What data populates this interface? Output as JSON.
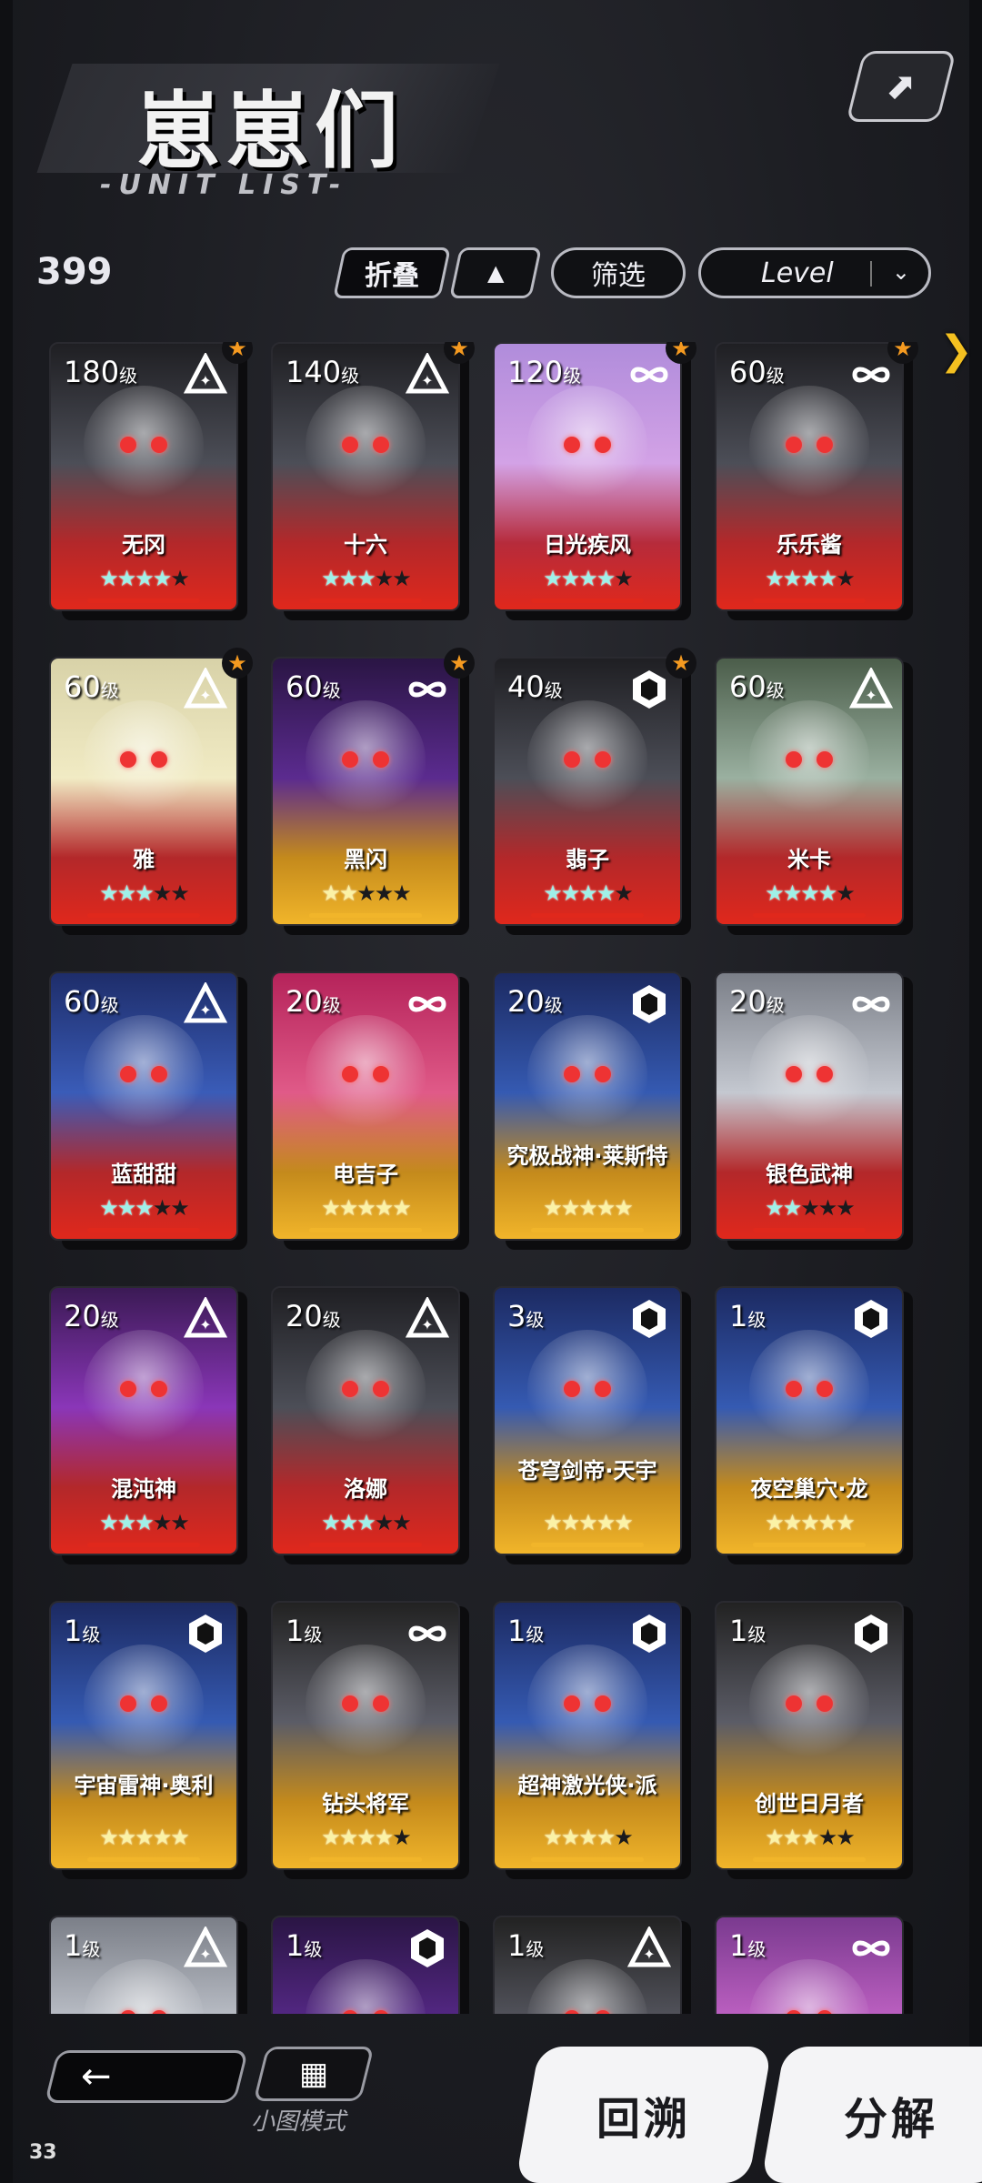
{
  "header": {
    "title": "崽崽们",
    "subtitle": "-UNIT LIST-",
    "count": "399",
    "fold_label": "折叠",
    "sort_dir_icon": "up-triangle-icon",
    "filter_label": "筛选",
    "sort_label": "Level",
    "corner_icon": "ranking-icon"
  },
  "colors": {
    "red_rarity": "#e0281c",
    "gold_rarity": "#f1b52a",
    "favorite": "#f59a20",
    "star_on": "#9ff0e8",
    "star_gold": "#fbf2a6"
  },
  "units": [
    {
      "level": "180",
      "name": "无冈",
      "type": "triangle",
      "fav": true,
      "stars": 4,
      "max": 5,
      "tier": "red",
      "face": "dark-red"
    },
    {
      "level": "140",
      "name": "十六",
      "type": "triangle",
      "fav": true,
      "stars": 3,
      "max": 5,
      "tier": "red",
      "face": "dark-red"
    },
    {
      "level": "120",
      "name": "日光疾风",
      "type": "infinity",
      "fav": true,
      "stars": 4,
      "max": 5,
      "tier": "red",
      "face": "lilac"
    },
    {
      "level": "60",
      "name": "乐乐酱",
      "type": "infinity",
      "fav": true,
      "stars": 4,
      "max": 5,
      "tier": "red",
      "face": "dark-red"
    },
    {
      "level": "60",
      "name": "雅",
      "type": "triangle",
      "fav": true,
      "stars": 3,
      "max": 5,
      "tier": "red",
      "face": "yellow-pale"
    },
    {
      "level": "60",
      "name": "黑闪",
      "type": "infinity",
      "fav": true,
      "stars": 2,
      "max": 5,
      "tier": "gold",
      "face": "violet"
    },
    {
      "level": "40",
      "name": "翡子",
      "type": "hexagon",
      "fav": true,
      "stars": 4,
      "max": 5,
      "tier": "red",
      "face": "dark-red"
    },
    {
      "level": "60",
      "name": "米卡",
      "type": "triangle",
      "fav": false,
      "stars": 4,
      "max": 5,
      "tier": "red",
      "face": "green"
    },
    {
      "level": "60",
      "name": "蓝甜甜",
      "type": "triangle",
      "fav": false,
      "stars": 3,
      "max": 5,
      "tier": "red",
      "face": "blue-red"
    },
    {
      "level": "20",
      "name": "电吉子",
      "type": "infinity",
      "fav": false,
      "stars": 5,
      "max": 5,
      "tier": "gold",
      "face": "pink"
    },
    {
      "level": "20",
      "name": "究极战神·莱斯特",
      "type": "hexagon",
      "fav": false,
      "stars": 5,
      "max": 5,
      "tier": "gold",
      "face": "blue"
    },
    {
      "level": "20",
      "name": "银色武神",
      "type": "infinity",
      "fav": false,
      "stars": 2,
      "max": 5,
      "tier": "red",
      "face": "silver"
    },
    {
      "level": "20",
      "name": "混沌神",
      "type": "triangle",
      "fav": false,
      "stars": 3,
      "max": 5,
      "tier": "red",
      "face": "purple-red"
    },
    {
      "level": "20",
      "name": "洛娜",
      "type": "triangle",
      "fav": false,
      "stars": 3,
      "max": 5,
      "tier": "red",
      "face": "dark-red"
    },
    {
      "level": "3",
      "name": "苍穹剑帝·天宇",
      "type": "hexagon",
      "fav": false,
      "stars": 5,
      "max": 5,
      "tier": "gold",
      "face": "blue"
    },
    {
      "level": "1",
      "name": "夜空巢穴·龙",
      "type": "hexagon",
      "fav": false,
      "stars": 5,
      "max": 5,
      "tier": "gold",
      "face": "blue"
    },
    {
      "level": "1",
      "name": "宇宙雷神·奥利",
      "type": "hexagon",
      "fav": false,
      "stars": 5,
      "max": 5,
      "tier": "gold",
      "face": "blue"
    },
    {
      "level": "1",
      "name": "钻头将军",
      "type": "infinity",
      "fav": false,
      "stars": 4,
      "max": 5,
      "tier": "gold",
      "face": "dark"
    },
    {
      "level": "1",
      "name": "超神激光侠·派",
      "type": "hexagon",
      "fav": false,
      "stars": 4,
      "max": 5,
      "tier": "gold",
      "face": "blue"
    },
    {
      "level": "1",
      "name": "创世日月者",
      "type": "hexagon",
      "fav": false,
      "stars": 3,
      "max": 5,
      "tier": "gold",
      "face": "dark"
    },
    {
      "level": "1",
      "name": "",
      "type": "triangle",
      "fav": false,
      "stars": 0,
      "max": 5,
      "tier": "red",
      "face": "silver"
    },
    {
      "level": "1",
      "name": "",
      "type": "hexagon",
      "fav": false,
      "stars": 0,
      "max": 5,
      "tier": "red",
      "face": "violet"
    },
    {
      "level": "1",
      "name": "",
      "type": "triangle",
      "fav": false,
      "stars": 0,
      "max": 5,
      "tier": "red",
      "face": "dark"
    },
    {
      "level": "1",
      "name": "",
      "type": "infinity",
      "fav": false,
      "stars": 0,
      "max": 5,
      "tier": "red",
      "face": "purple"
    }
  ],
  "level_suffix": "级",
  "footer": {
    "back_icon": "left-arrow-icon",
    "mini_icon": "grid-icon",
    "mini_label": "小图模式",
    "recall_label": "回溯",
    "decompose_label": "分解",
    "page_number": "33"
  }
}
